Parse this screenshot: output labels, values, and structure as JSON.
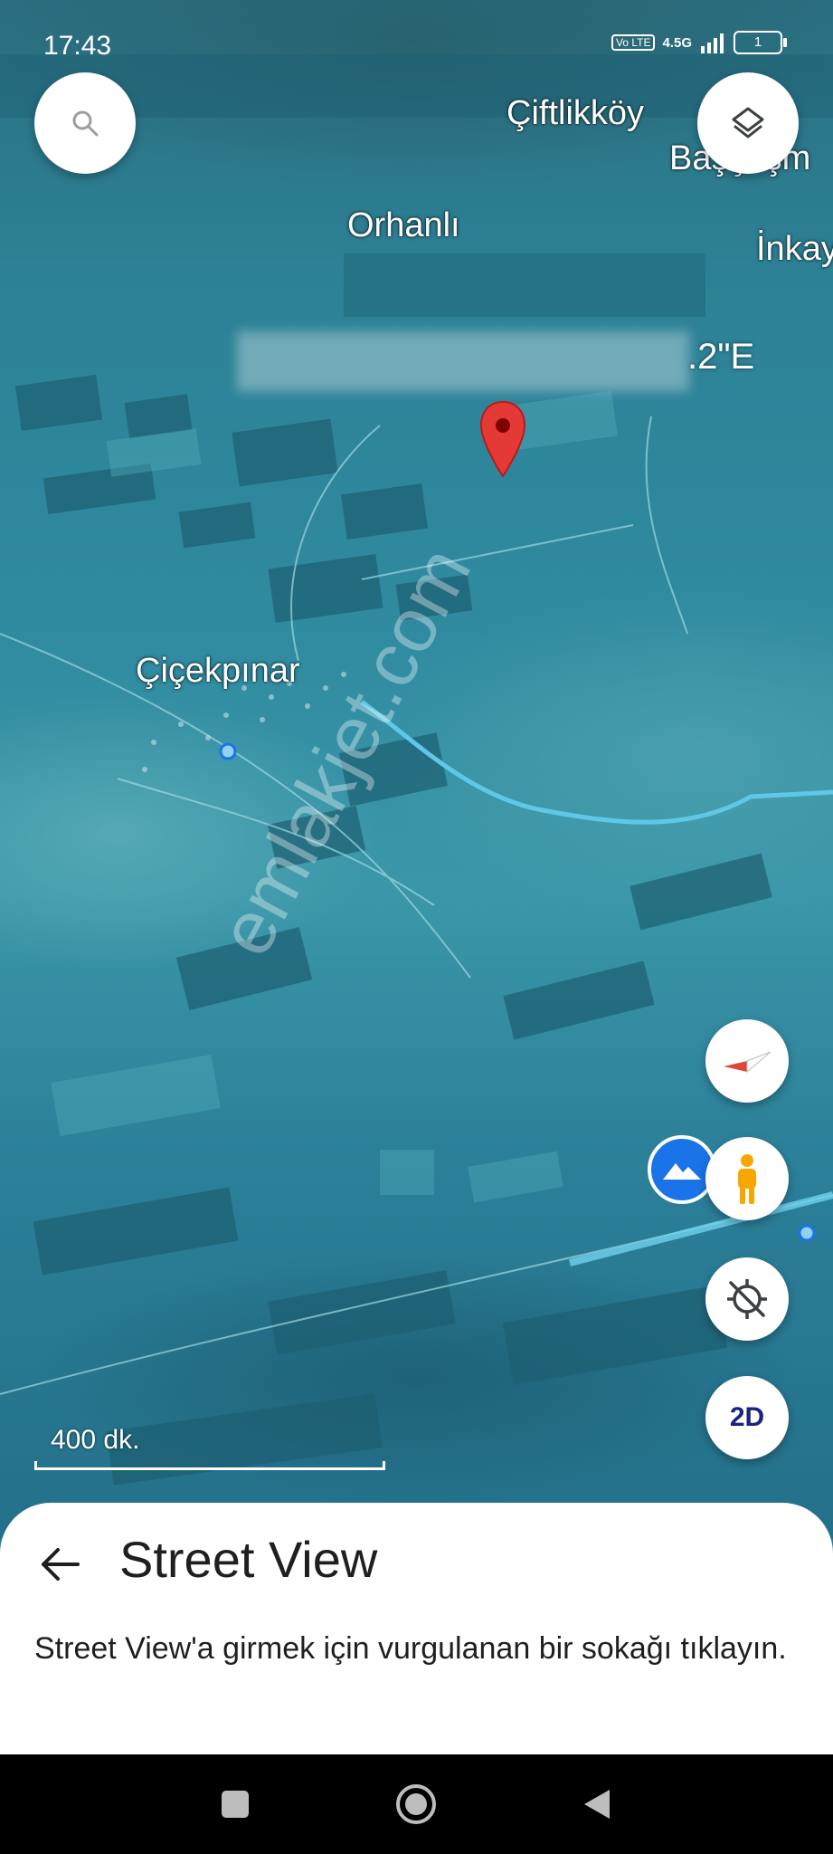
{
  "status_bar": {
    "time": "17:43",
    "network": "4.5G",
    "volte": "Vo LTE",
    "battery": "1"
  },
  "map": {
    "places": [
      "Çiftlikköy",
      "Başçeşm",
      "Orhanlı",
      "İnkay",
      "Çiçekpınar"
    ],
    "coordinate_suffix": ".2\"E",
    "watermark": "emlakjet.com",
    "scale_label": "400 dk.",
    "buttons": {
      "view_toggle": "2D"
    }
  },
  "icons": [
    "search-icon",
    "layers-icon",
    "compass-icon",
    "terrain-icon",
    "pegman-icon",
    "location-off-icon",
    "location-pin-icon"
  ],
  "colors": {
    "pin": "#e53935",
    "accent_blue": "#1a73e8",
    "pegman": "#f6a800",
    "compass_red": "#e0453a"
  },
  "sheet": {
    "title": "Street View",
    "description": "Street View'a girmek için vurgulanan bir sokağı tıklayın."
  },
  "nav_bar": {
    "items": [
      "recents-button",
      "home-button",
      "back-button"
    ]
  }
}
